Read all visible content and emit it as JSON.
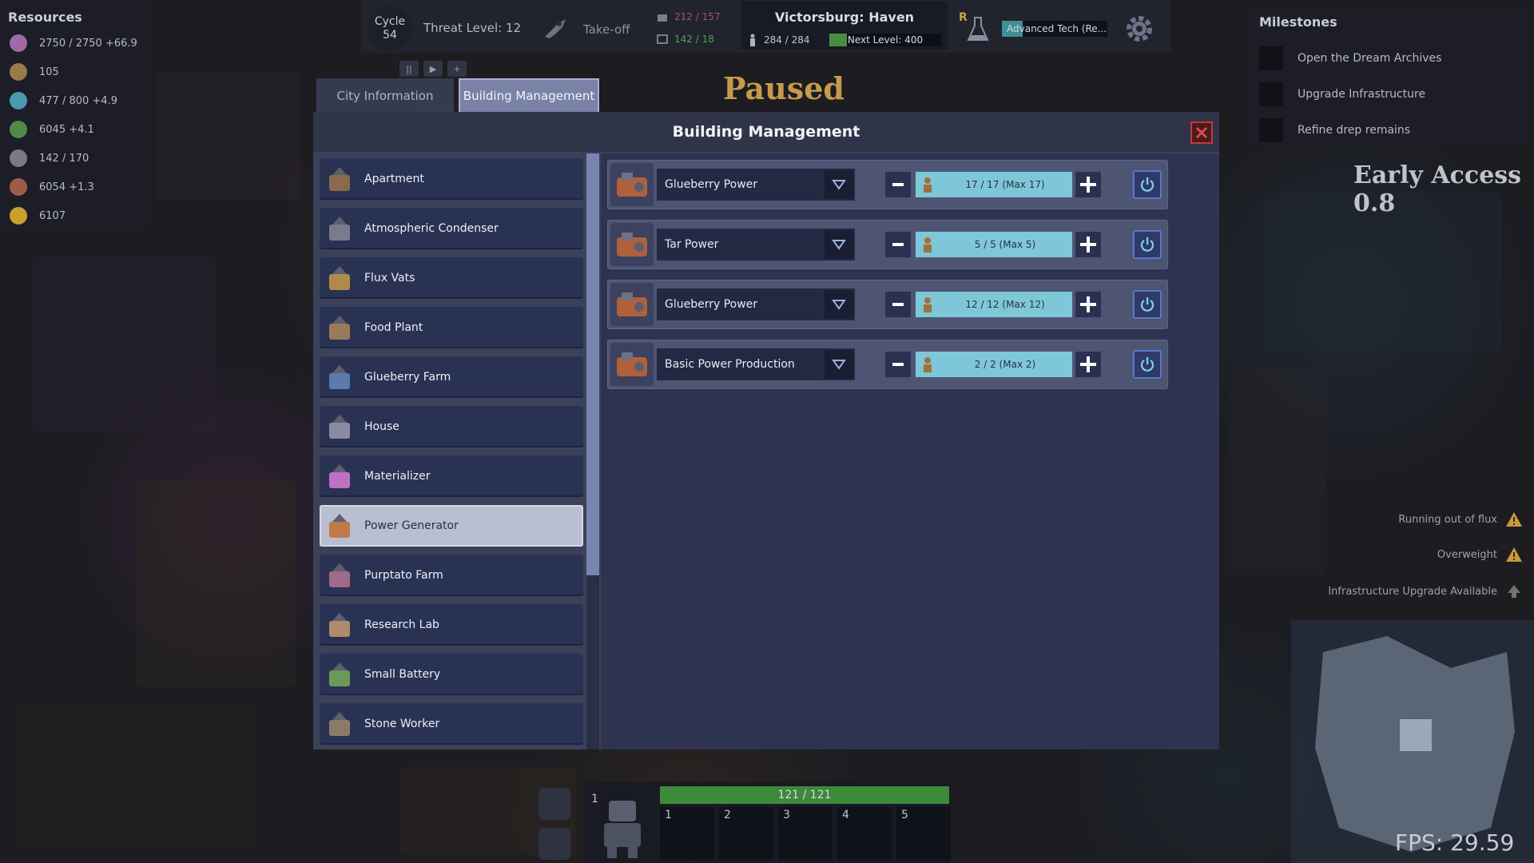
{
  "resources": {
    "title": "Resources",
    "items": [
      {
        "icon": "flux-icon",
        "text": "2750 / 2750 +66.9",
        "color": "#a06aa8"
      },
      {
        "icon": "worker-icon",
        "text": "105",
        "color": "#9a7a4a"
      },
      {
        "icon": "energy-icon",
        "text": "477 / 800 +4.9",
        "color": "#4a9ab0"
      },
      {
        "icon": "plant-icon",
        "text": "6045 +4.1",
        "color": "#4f8a4a"
      },
      {
        "icon": "stone-icon",
        "text": "142 / 170",
        "color": "#7a7a80"
      },
      {
        "icon": "food-icon",
        "text": "6054 +1.3",
        "color": "#a05a4a"
      },
      {
        "icon": "gold-icon",
        "text": "6107",
        "color": "#c8a02a"
      }
    ]
  },
  "topbar": {
    "cycle_label": "Cycle",
    "cycle_value": "54",
    "threat": "Threat Level: 12",
    "takeoff": "Take-off",
    "capacity_a": "212 / 157",
    "capacity_b": "142 / 18",
    "city_name": "Victorsburg: Haven",
    "population": "284 / 284",
    "next_level": "Next Level: 400",
    "next_level_progress": 0.16,
    "research_letter": "R",
    "research_text": "Advanced Tech (Re...",
    "research_progress": 0.2
  },
  "paused_text": "Paused",
  "speed_controls": [
    "||",
    "▶",
    "+"
  ],
  "milestones": {
    "title": "Milestones",
    "items": [
      "Open the Dream Archives",
      "Upgrade Infrastructure",
      "Refine drep remains"
    ]
  },
  "early_access": "Early Access 0.8",
  "alerts": [
    "Running out of flux",
    "Overweight",
    "Infrastructure Upgrade Available"
  ],
  "fps": "FPS: 29.59",
  "hotbar": {
    "hp": "121 / 121",
    "hp_progress": 1.0,
    "group": "1",
    "slots": [
      "1",
      "2",
      "3",
      "4",
      "5"
    ]
  },
  "tabs": {
    "city": "City Information",
    "building": "Building Management"
  },
  "dialog": {
    "title": "Building Management",
    "buildings": [
      {
        "label": "Apartment",
        "icon": "apartment-icon"
      },
      {
        "label": "Atmospheric Condenser",
        "icon": "condenser-icon"
      },
      {
        "label": "Flux Vats",
        "icon": "flux-vats-icon"
      },
      {
        "label": "Food Plant",
        "icon": "food-plant-icon"
      },
      {
        "label": "Glueberry Farm",
        "icon": "glueberry-farm-icon"
      },
      {
        "label": "House",
        "icon": "house-icon"
      },
      {
        "label": "Materializer",
        "icon": "materializer-icon"
      },
      {
        "label": "Power Generator",
        "icon": "power-generator-icon"
      },
      {
        "label": "Purptato Farm",
        "icon": "purptato-farm-icon"
      },
      {
        "label": "Research Lab",
        "icon": "research-lab-icon"
      },
      {
        "label": "Small Battery",
        "icon": "small-battery-icon"
      },
      {
        "label": "Stone Worker",
        "icon": "stone-worker-icon"
      }
    ],
    "selected": "Power Generator",
    "productions": [
      {
        "recipe": "Glueberry Power",
        "count": "17 / 17 (Max 17)"
      },
      {
        "recipe": "Tar Power",
        "count": "5 / 5 (Max 5)"
      },
      {
        "recipe": "Glueberry Power",
        "count": "12 / 12 (Max 12)"
      },
      {
        "recipe": "Basic Power Production",
        "count": "2 / 2 (Max 2)"
      }
    ]
  },
  "colors": {
    "dialog_bg": "#3b4159",
    "list_item": "#2a3254",
    "selected_item": "#b9bed1",
    "count_bar": "#7ec7d8",
    "close_red": "#c23a3a"
  }
}
